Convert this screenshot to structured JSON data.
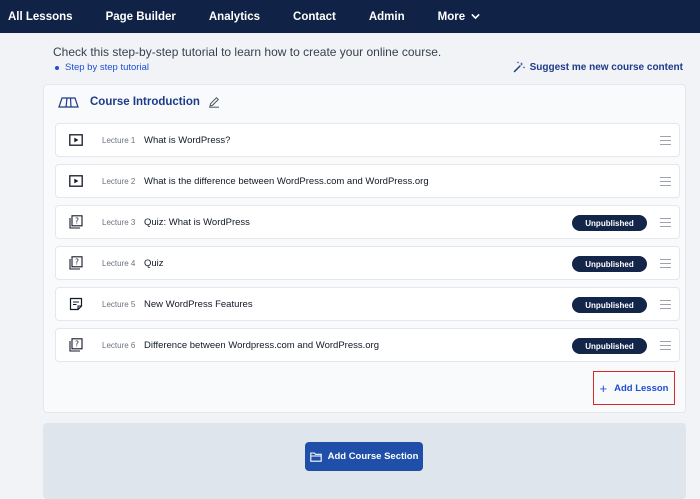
{
  "nav": {
    "items": [
      {
        "label": "All Lessons"
      },
      {
        "label": "Page Builder"
      },
      {
        "label": "Analytics"
      },
      {
        "label": "Contact"
      },
      {
        "label": "Admin"
      },
      {
        "label": "More",
        "icon": "chevron-down-icon"
      }
    ]
  },
  "header": {
    "intro": "Check this step-by-step tutorial to learn how to create your online course.",
    "tutorial_link": "Step by step tutorial",
    "suggest_label": "Suggest me new course content",
    "suggest_icon": "magic-wand-icon"
  },
  "section": {
    "title": "Course Introduction",
    "icon": "section-icon",
    "edit_icon": "pencil-icon",
    "lectures": [
      {
        "number": "Lecture 1",
        "title": "What is WordPress?",
        "icon": "video-icon",
        "status": ""
      },
      {
        "number": "Lecture 2",
        "title": "What is the difference between WordPress.com and WordPress.org",
        "icon": "video-icon",
        "status": ""
      },
      {
        "number": "Lecture 3",
        "title": "Quiz: What is WordPress",
        "icon": "quiz-icon",
        "status": "Unpublished"
      },
      {
        "number": "Lecture 4",
        "title": "Quiz",
        "icon": "quiz-icon",
        "status": "Unpublished"
      },
      {
        "number": "Lecture 5",
        "title": "New WordPress Features",
        "icon": "text-icon",
        "status": "Unpublished"
      },
      {
        "number": "Lecture 6",
        "title": "Difference between Wordpress.com and WordPress.org",
        "icon": "quiz-icon",
        "status": "Unpublished"
      }
    ],
    "add_lesson_label": "Add Lesson"
  },
  "footer": {
    "add_section_label": "Add Course Section",
    "add_section_icon": "folder-icon"
  },
  "colors": {
    "nav_bg": "#102347",
    "accent": "#1d4ed8",
    "badge_bg": "#14254a",
    "highlight": "#dc2626",
    "button_bg": "#1f4fa8"
  }
}
